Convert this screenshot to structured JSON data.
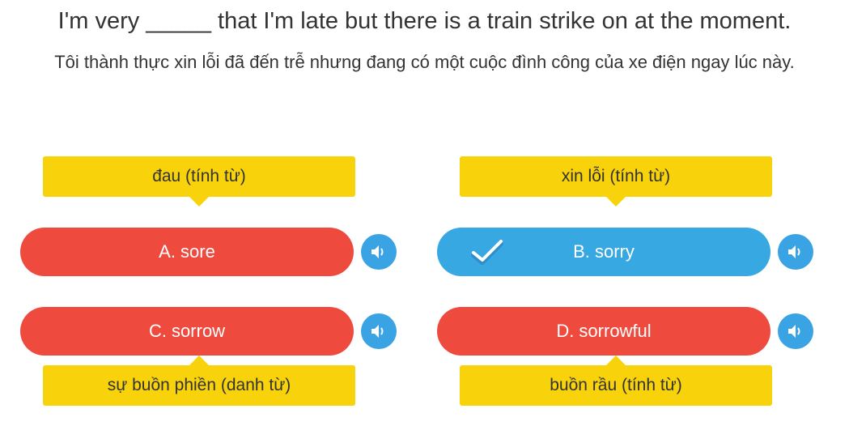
{
  "question": {
    "text": "I'm very _____ that I'm late but there is a train strike on at the moment.",
    "translation": "Tôi thành thực xin lỗi đã đến trễ nhưng đang có một cuộc đình công của xe điện ngay lúc này."
  },
  "options": [
    {
      "label": "A. sore",
      "hint": "đau (tính từ)",
      "status": "wrong",
      "icon": "speaker-icon"
    },
    {
      "label": "B. sorry",
      "hint": "xin lỗi (tính từ)",
      "status": "correct",
      "icon": "speaker-icon"
    },
    {
      "label": "C. sorrow",
      "hint": "sự buồn phiền (danh từ)",
      "status": "wrong",
      "icon": "speaker-icon"
    },
    {
      "label": "D. sorrowful",
      "hint": "buồn rầu (tính từ)",
      "status": "wrong",
      "icon": "speaker-icon"
    }
  ],
  "colors": {
    "wrong": "#ef4a3e",
    "correct": "#37a8e2",
    "hint": "#f8d20b",
    "audio": "#3aa3e4"
  }
}
